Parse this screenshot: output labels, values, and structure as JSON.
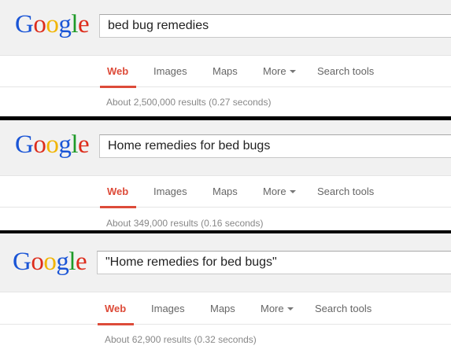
{
  "panels": [
    {
      "logo": [
        "G",
        "o",
        "o",
        "g",
        "l",
        "e"
      ],
      "query": "bed bug remedies",
      "tabs": {
        "web": "Web",
        "images": "Images",
        "maps": "Maps",
        "more": "More",
        "tools": "Search tools"
      },
      "stats": "About 2,500,000 results (0.27 seconds)"
    },
    {
      "logo": [
        "G",
        "o",
        "o",
        "g",
        "l",
        "e"
      ],
      "query": "Home remedies for bed bugs",
      "tabs": {
        "web": "Web",
        "images": "Images",
        "maps": "Maps",
        "more": "More",
        "tools": "Search tools"
      },
      "stats": "About 349,000 results (0.16 seconds)"
    },
    {
      "logo": [
        "G",
        "o",
        "o",
        "g",
        "l",
        "e"
      ],
      "query": "\"Home remedies for bed bugs\"",
      "tabs": {
        "web": "Web",
        "images": "Images",
        "maps": "Maps",
        "more": "More",
        "tools": "Search tools"
      },
      "stats": "About 62,900 results (0.32 seconds)"
    }
  ],
  "colors": {
    "logo": [
      "#1a55d6",
      "#dd2c1b",
      "#f1b400",
      "#1a55d6",
      "#1d9a27",
      "#dd2c1b"
    ],
    "accent": "#dd4b39",
    "divider": "#000000"
  }
}
